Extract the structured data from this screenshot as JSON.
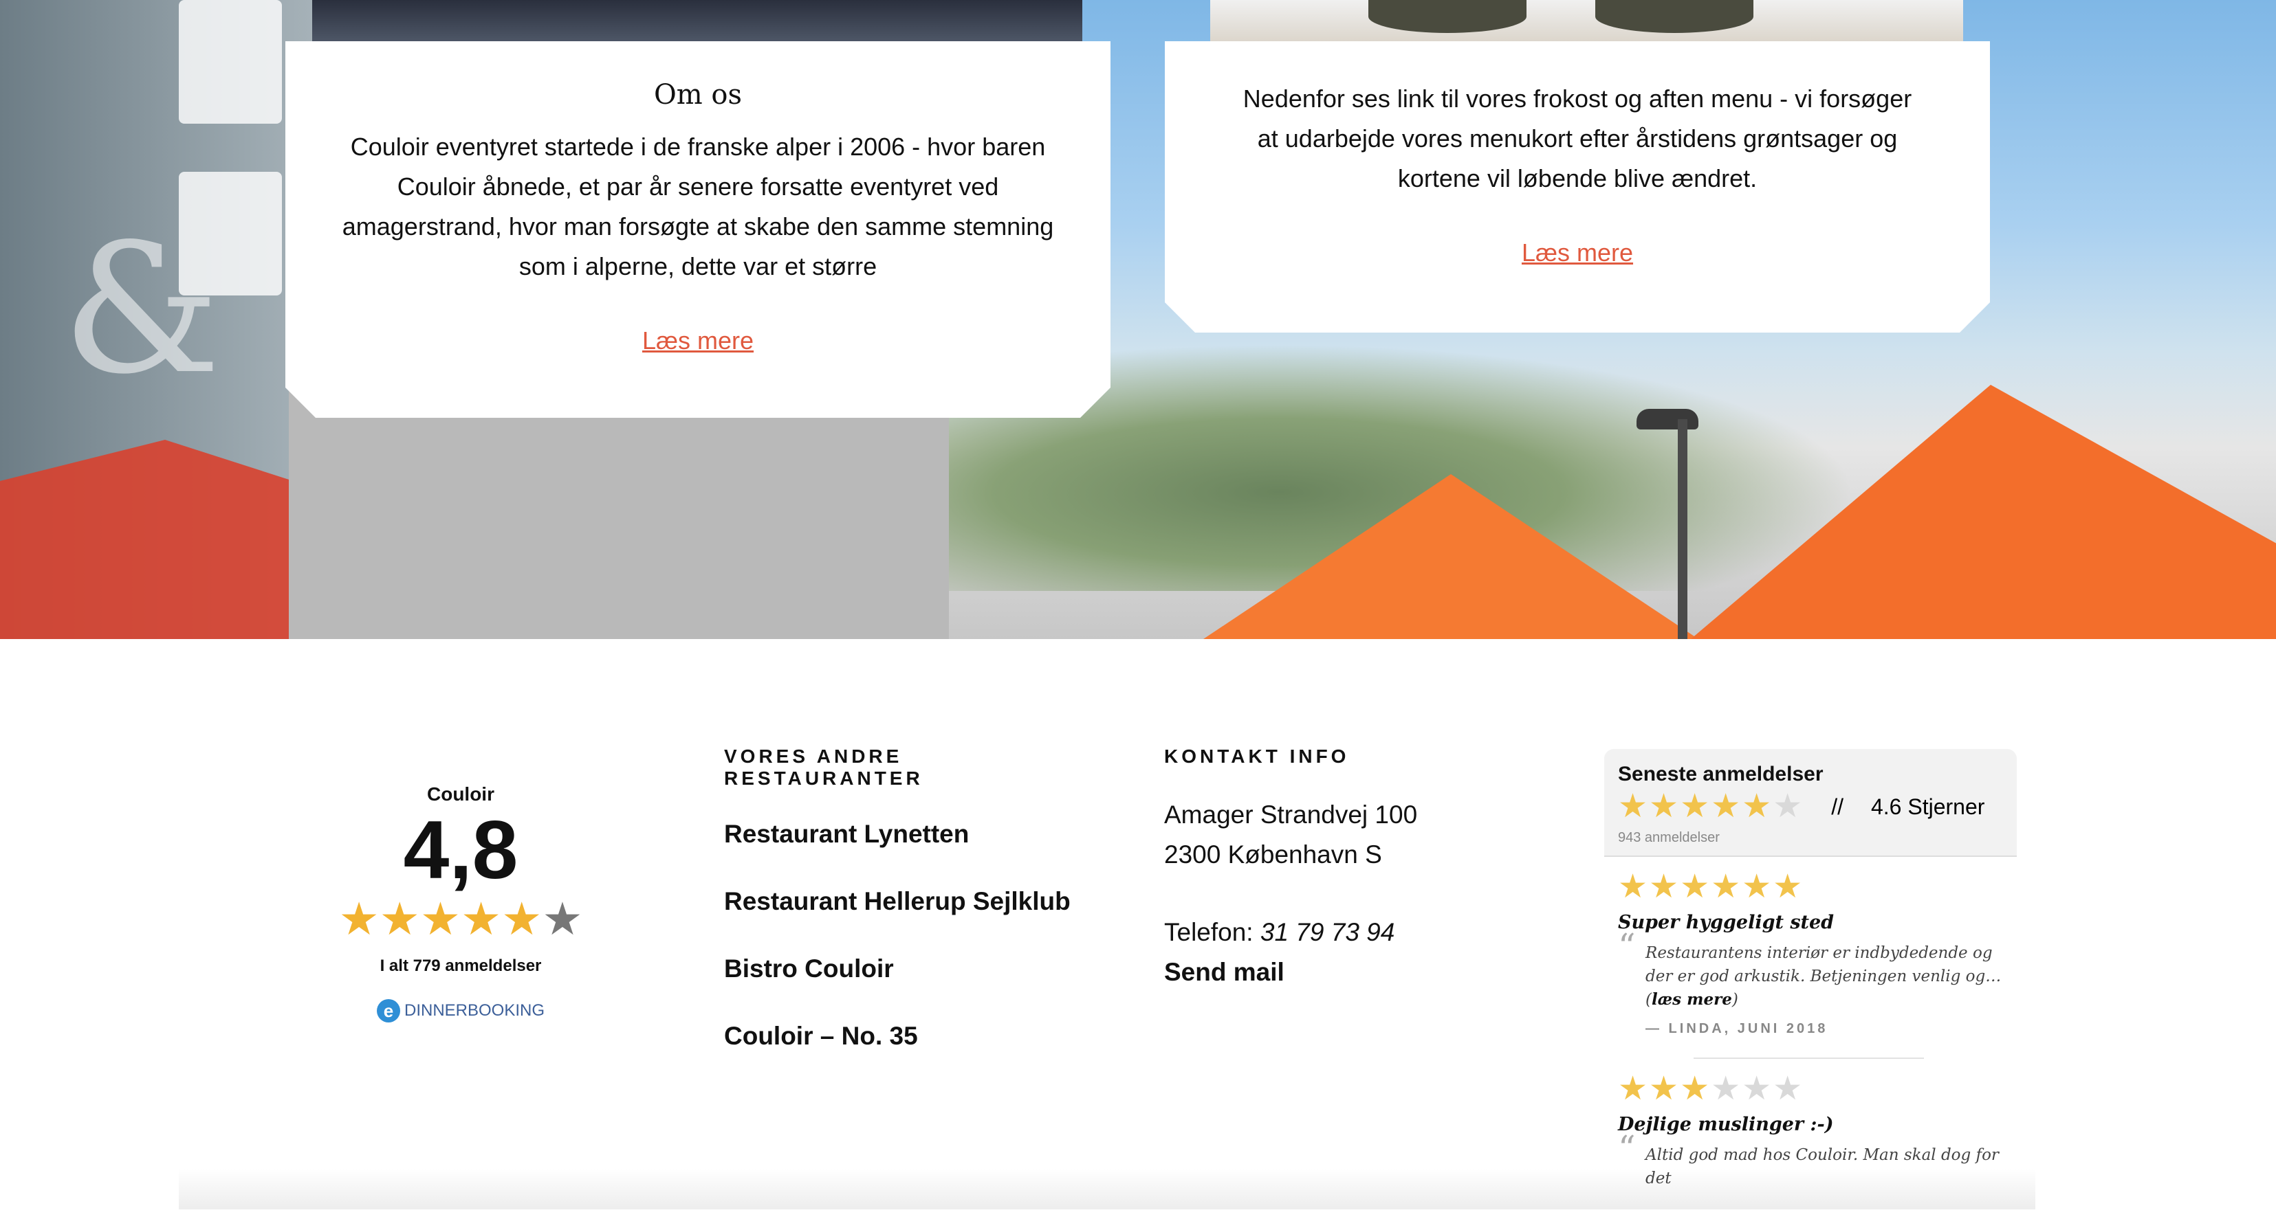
{
  "about_card": {
    "title": "Om os",
    "text": "Couloir eventyret startede i de franske alper i 2006 - hvor baren Couloir åbnede, et par år senere forsatte eventyret ved amagerstrand, hvor man forsøgte at skabe den samme stemning som i alperne, dette var et større",
    "link": "Læs mere"
  },
  "menu_card": {
    "text": "Nedenfor ses link til vores frokost og aften menu - vi forsøger at udarbejde vores menukort efter årstidens grøntsager og kortene vil løbende blive ændret.",
    "link": "Læs mere"
  },
  "rating_widget": {
    "name": "Couloir",
    "score": "4,8",
    "stars_filled": 5,
    "stars_total": 6,
    "total": "I alt 779 anmeldelser",
    "provider": "DINNERBOOKING",
    "colors": {
      "star_on": "#f2b230",
      "star_off": "#777777"
    }
  },
  "restaurants": {
    "heading": "VORES ANDRE RESTAURANTER",
    "items": [
      "Restaurant Lynetten",
      "Restaurant Hellerup Sejlklub",
      "Bistro Couloir",
      "Couloir – No. 35"
    ]
  },
  "contact": {
    "heading": "KONTAKT INFO",
    "address_line1": "Amager Strandvej 100",
    "address_line2": "2300 København S",
    "phone_label": "Telefon:",
    "phone_number": "31 79 73 94",
    "mail_link": "Send mail"
  },
  "reviews": {
    "heading": "Seneste anmeldelser",
    "average_rating": 4.6,
    "separator": "//",
    "average_label": "4.6 Stjerner",
    "count": "943 anmeldelser",
    "items": [
      {
        "rating": 6,
        "title": "Super hyggeligt sted",
        "body": "Restaurantens interiør er indbydedende og der er god arkustik. Betjeningen venlig og… (",
        "more": "læs mere",
        "body_end": ")",
        "author": "— LINDA, JUNI 2018"
      },
      {
        "rating": 3,
        "title": "Dejlige muslinger :-)",
        "body": "Altid god mad hos Couloir. Man skal dog for det"
      }
    ]
  },
  "colors": {
    "accent_link": "#e0593e"
  }
}
